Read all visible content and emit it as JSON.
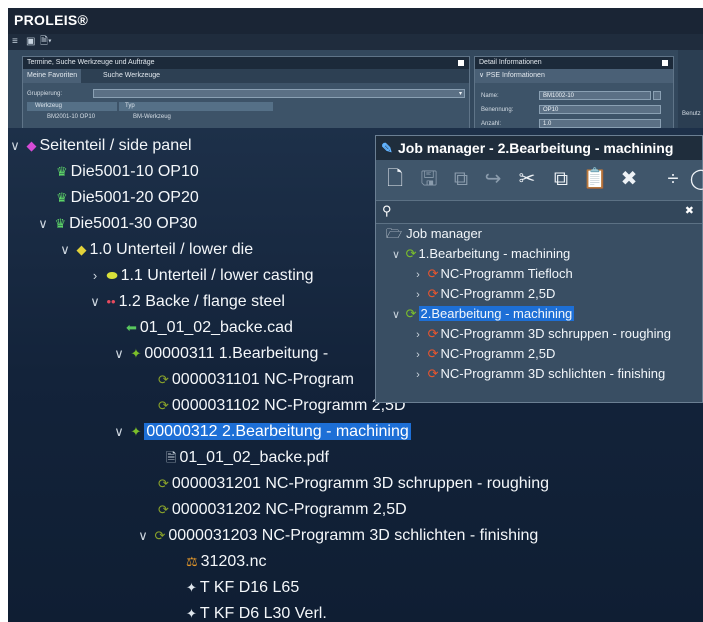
{
  "app": {
    "title": "PROLEIS®"
  },
  "background_panel": {
    "left_pane": {
      "header": "Termine, Suche Werkzeuge und Aufträge",
      "tabs": [
        "Meine Favoriten",
        "Suche Werkzeuge"
      ],
      "grouping_label": "Gruppierung:",
      "col_werkzeug": "Werkzeug",
      "col_typ": "Typ",
      "row_werkzeug": "BM2001-10 OP10",
      "row_typ": "BM-Werkzeug"
    },
    "right_pane": {
      "header": "Detail Informationen",
      "section": "PSE Informationen",
      "fields": [
        {
          "label": "Name:",
          "value": "BM1002-10"
        },
        {
          "label": "Benennung:",
          "value": "OP10"
        },
        {
          "label": "Anzahl:",
          "value": "1.0"
        }
      ]
    },
    "far_right": {
      "text": "Benutz"
    }
  },
  "tree": {
    "nodes": [
      {
        "chev": "∨",
        "label": "Seitenteil / side panel"
      },
      {
        "chev": "",
        "label": "Die5001-10 OP10"
      },
      {
        "chev": "",
        "label": "Die5001-20 OP20"
      },
      {
        "chev": "∨",
        "label": "Die5001-30 OP30"
      },
      {
        "chev": "∨",
        "label": "1.0 Unterteil / lower die"
      },
      {
        "chev": "›",
        "label": "1.1 Unterteil / lower casting"
      },
      {
        "chev": "∨",
        "label": "1.2 Backe / flange steel"
      },
      {
        "chev": "",
        "label": "01_01_02_backe.cad"
      },
      {
        "chev": "∨",
        "label": "00000311 1.Bearbeitung -"
      },
      {
        "chev": "",
        "label": "0000031101 NC-Program"
      },
      {
        "chev": "",
        "label": "0000031102 NC-Programm 2,5D"
      },
      {
        "chev": "∨",
        "label": "00000312 2.Bearbeitung - machining"
      },
      {
        "chev": "",
        "label": "01_01_02_backe.pdf"
      },
      {
        "chev": "",
        "label": "0000031201 NC-Programm 3D schruppen - roughing"
      },
      {
        "chev": "",
        "label": "0000031202 NC-Programm 2,5D"
      },
      {
        "chev": "∨",
        "label": "0000031203 NC-Programm 3D schlichten - finishing"
      },
      {
        "chev": "",
        "label": "31203.nc"
      },
      {
        "chev": "",
        "label": "T KF D16 L65"
      },
      {
        "chev": "",
        "label": "T KF D6 L30 Verl."
      }
    ]
  },
  "job_manager": {
    "title": "Job manager - 2.Bearbeitung - machining",
    "search_placeholder": "",
    "root": "Job manager",
    "nodes": [
      {
        "chev": "∨",
        "label": "1.Bearbeitung - machining"
      },
      {
        "chev": "›",
        "label": "NC-Programm Tiefloch"
      },
      {
        "chev": "›",
        "label": "NC-Programm 2,5D"
      },
      {
        "chev": "∨",
        "label": "2.Bearbeitung - machining"
      },
      {
        "chev": "›",
        "label": "NC-Programm 3D schruppen - roughing"
      },
      {
        "chev": "›",
        "label": "NC-Programm 2,5D"
      },
      {
        "chev": "›",
        "label": "NC-Programm 3D schlichten - finishing"
      }
    ]
  },
  "colors": {
    "selection": "#1d6fd6",
    "nc_program": "#e8542e",
    "machining": "#7bbf2a",
    "tree_bg": "#13233a"
  }
}
